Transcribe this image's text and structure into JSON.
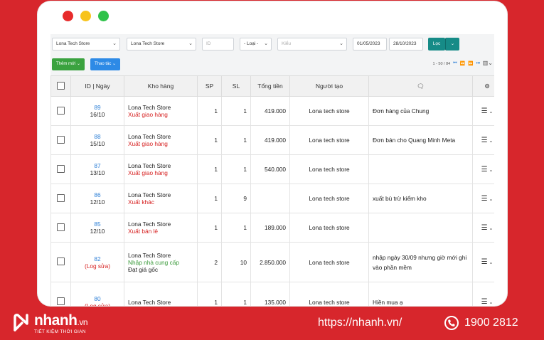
{
  "filters": {
    "store1": "Lona Tech Store",
    "store2": "Lona Tech Store",
    "id_placeholder": "ID",
    "loai": "- Loại -",
    "kieu_placeholder": "Kiểu",
    "date_from": "01/05/2023",
    "date_to": "28/10/2023",
    "filter_button": "Lọc"
  },
  "toolbar": {
    "add_button": "Thêm mới",
    "action_button": "Thao tác",
    "pager_text": "1 - 50 / 84"
  },
  "colors": {
    "green": "#3aa23f",
    "blue": "#2d8ae6",
    "teal": "#168b87",
    "brand_red": "#d7262c"
  },
  "table": {
    "headers": [
      "ID | Ngày",
      "Kho hàng",
      "SP",
      "SL",
      "Tổng tiền",
      "Người tạo"
    ],
    "rows": [
      {
        "id": "89",
        "date": "16/10",
        "log": "",
        "store": "Lona Tech Store",
        "type": "Xuất giao hàng",
        "type_color": "red",
        "extra": "",
        "sp": "1",
        "sl": "1",
        "total": "419.000",
        "creator": "Lona tech store",
        "note": "Đơn hàng của Chung"
      },
      {
        "id": "88",
        "date": "15/10",
        "log": "",
        "store": "Lona Tech Store",
        "type": "Xuất giao hàng",
        "type_color": "red",
        "extra": "",
        "sp": "1",
        "sl": "1",
        "total": "419.000",
        "creator": "Lona tech store",
        "note": "Đơn bán cho Quang Minh Meta"
      },
      {
        "id": "87",
        "date": "13/10",
        "log": "",
        "store": "Lona Tech Store",
        "type": "Xuất giao hàng",
        "type_color": "red",
        "extra": "",
        "sp": "1",
        "sl": "1",
        "total": "540.000",
        "creator": "Lona tech store",
        "note": ""
      },
      {
        "id": "86",
        "date": "12/10",
        "log": "",
        "store": "Lona Tech Store",
        "type": "Xuất khác",
        "type_color": "red",
        "extra": "",
        "sp": "1",
        "sl": "9",
        "total": "",
        "creator": "Lona tech store",
        "note": "xuất bù trừ kiểm kho"
      },
      {
        "id": "85",
        "date": "12/10",
        "log": "",
        "store": "Lona Tech Store",
        "type": "Xuất bán lẻ",
        "type_color": "red",
        "extra": "",
        "sp": "1",
        "sl": "1",
        "total": "189.000",
        "creator": "Lona tech store",
        "note": ""
      },
      {
        "id": "82",
        "date": "",
        "log": "(Log sửa)",
        "store": "Lona Tech Store",
        "type": "Nhập nhà cung cấp",
        "type_color": "green",
        "extra": "Đạt giá gốc",
        "sp": "2",
        "sl": "10",
        "total": "2.850.000",
        "creator": "Lona tech store",
        "note": "nhập ngày 30/09 nhưng giờ mới ghi vào phần mềm"
      },
      {
        "id": "80",
        "date": "",
        "log": "(Log sửa)",
        "store": "Lona Tech Store",
        "type": "",
        "type_color": "red",
        "extra": "",
        "sp": "1",
        "sl": "1",
        "total": "135.000",
        "creator": "Lona tech store",
        "note": "Hiền mua ạ"
      }
    ]
  },
  "footer": {
    "logo": "nhanh",
    "logo_suffix": ".vn",
    "tagline": "TIẾT KIỆM THỜI GIAN",
    "url": "https://nhanh.vn/",
    "phone": "1900 2812"
  }
}
